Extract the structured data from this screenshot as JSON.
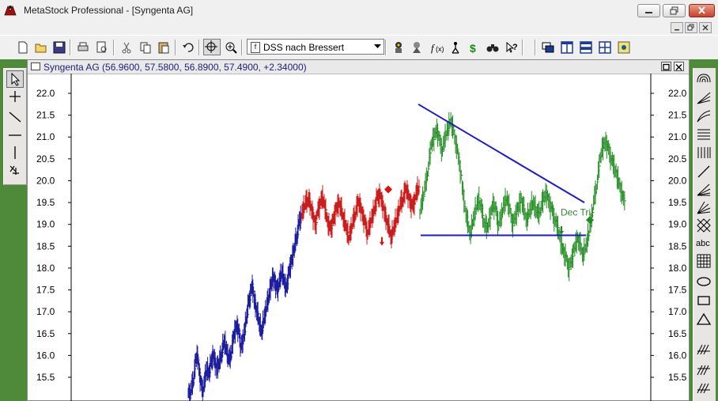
{
  "window": {
    "title": "MetaStock Professional - [Syngenta AG]"
  },
  "toolbar": {
    "formula_selector": "DSS nach Bressert",
    "icons": [
      "new-icon",
      "open-icon",
      "save-icon",
      "print-icon",
      "print-preview-icon",
      "cut-icon",
      "copy-icon",
      "paste-icon",
      "undo-icon",
      "crosshair-icon",
      "zoom-icon",
      "expert-icon",
      "explorer-icon",
      "indicator-builder-icon",
      "system-tester-icon",
      "dollar-icon",
      "binoculars-icon",
      "help-icon",
      "window-tile-icon",
      "columns-icon",
      "rows-icon",
      "grid-icon",
      "layout-icon"
    ]
  },
  "left_tools": [
    "pointer-icon",
    "cross-icon",
    "trendline-icon",
    "horizontal-line-icon",
    "vertical-line-icon",
    "cut-tool-icon"
  ],
  "right_tools": [
    "cycle-icon",
    "fan-icon",
    "arc-icon",
    "retracement-icon",
    "vertical-bars-icon",
    "line-icon",
    "speed-lines-icon",
    "gann-fan-icon",
    "grid-tool-icon",
    "text-tool-icon",
    "table-tool-icon",
    "ellipse-icon",
    "rectangle-icon",
    "triangle-icon",
    "tools-more-icon",
    "tools-more-2-icon",
    "tools-more-3-icon"
  ],
  "chart_window": {
    "caption": "Syngenta AG (56.9600, 57.5800, 56.8900, 57.4900, +2.34000)"
  },
  "chart_data": {
    "type": "bar",
    "description_type": "ohlc",
    "title": "",
    "ylim": [
      15.1,
      22.35
    ],
    "y_ticks": [
      "22.0",
      "21.5",
      "21.0",
      "20.5",
      "20.0",
      "19.5",
      "19.0",
      "18.5",
      "18.0",
      "17.5",
      "17.0",
      "16.5",
      "16.0",
      "15.5"
    ],
    "series": [
      {
        "name": "",
        "color": "#1a1aa0",
        "x_range": [
          237,
          380
        ],
        "values": [
          15.2,
          15.1,
          15.3,
          15.5,
          15.9,
          16.0,
          15.6,
          15.3,
          15.2,
          15.5,
          15.7,
          15.6,
          15.8,
          16.0,
          15.9,
          15.7,
          15.8,
          15.9,
          16.1,
          16.3,
          16.2,
          16.0,
          15.9,
          16.1,
          16.4,
          16.6,
          16.7,
          16.5,
          16.2,
          16.3,
          16.6,
          16.9,
          17.2,
          17.4,
          17.6,
          17.3,
          17.1,
          16.9,
          16.7,
          16.5,
          16.8,
          17.0,
          17.2,
          17.4,
          17.6,
          17.8,
          17.7,
          17.5,
          17.6,
          17.8,
          17.9,
          17.7,
          17.5,
          17.8,
          18.0,
          18.2,
          18.4,
          18.6,
          18.8,
          19.1
        ]
      },
      {
        "name": "",
        "color": "#c81e1e",
        "x_range": [
          380,
          530
        ],
        "values": [
          19.2,
          19.4,
          19.5,
          19.6,
          19.4,
          19.2,
          19.0,
          19.3,
          19.5,
          19.6,
          19.4,
          19.1,
          18.9,
          19.0,
          19.2,
          19.4,
          19.5,
          19.3,
          19.1,
          18.9,
          18.7,
          18.9,
          19.1,
          19.3,
          19.5,
          19.4,
          19.2,
          19.0,
          18.8,
          19.0,
          19.2,
          19.4,
          19.6,
          19.7,
          19.5,
          19.3,
          19.1,
          18.9,
          18.7,
          18.9,
          19.1,
          19.3,
          19.5,
          19.6,
          19.8,
          19.7,
          19.5,
          19.4,
          19.6,
          19.8
        ]
      },
      {
        "name": "",
        "color": "#1e8c1e",
        "x_range": [
          530,
          790
        ],
        "values": [
          19.3,
          19.6,
          19.9,
          20.3,
          20.8,
          21.0,
          21.2,
          20.9,
          20.7,
          21.0,
          21.2,
          21.4,
          21.1,
          20.8,
          20.4,
          19.9,
          19.4,
          19.0,
          18.8,
          19.1,
          19.4,
          19.6,
          19.3,
          19.0,
          18.9,
          19.2,
          19.5,
          19.3,
          19.0,
          19.2,
          19.5,
          19.6,
          19.3,
          19.0,
          19.2,
          19.4,
          19.6,
          19.3,
          19.1,
          19.3,
          19.5,
          19.4,
          19.2,
          19.4,
          19.6,
          19.7,
          19.5,
          19.3,
          19.1,
          18.9,
          18.6,
          18.4,
          18.2,
          18.0,
          18.2,
          18.5,
          18.7,
          18.5,
          18.3,
          18.5,
          18.8,
          19.2,
          19.6,
          20.0,
          20.5,
          20.8,
          20.9,
          20.7,
          20.5,
          20.3,
          20.1,
          19.9,
          19.6
        ]
      }
    ],
    "annotations": [
      {
        "type": "line",
        "color": "#1a1ad2",
        "points": [
          [
            528,
            21.75
          ],
          [
            738,
            19.5
          ]
        ]
      },
      {
        "type": "line",
        "color": "#1a1ad2",
        "points": [
          [
            531,
            18.75
          ],
          [
            740,
            18.75
          ]
        ]
      },
      {
        "type": "text",
        "text": "Dec Tri",
        "color": "#2e8b2e",
        "x": 708,
        "y": 19.2
      },
      {
        "type": "marker",
        "shape": "diamond",
        "color": "#e01010",
        "x": 490,
        "y": 19.8
      },
      {
        "type": "marker",
        "shape": "diamond",
        "color": "#1e8c1e",
        "x": 745,
        "y": 19.1
      },
      {
        "type": "marker",
        "shape": "arrow-down",
        "color": "#e01010",
        "x": 482,
        "y": 18.6
      },
      {
        "type": "marker",
        "shape": "arrow-down",
        "color": "#1e8c1e",
        "x": 709,
        "y": 18.85
      }
    ],
    "grid": false,
    "axes": "both-sides"
  }
}
